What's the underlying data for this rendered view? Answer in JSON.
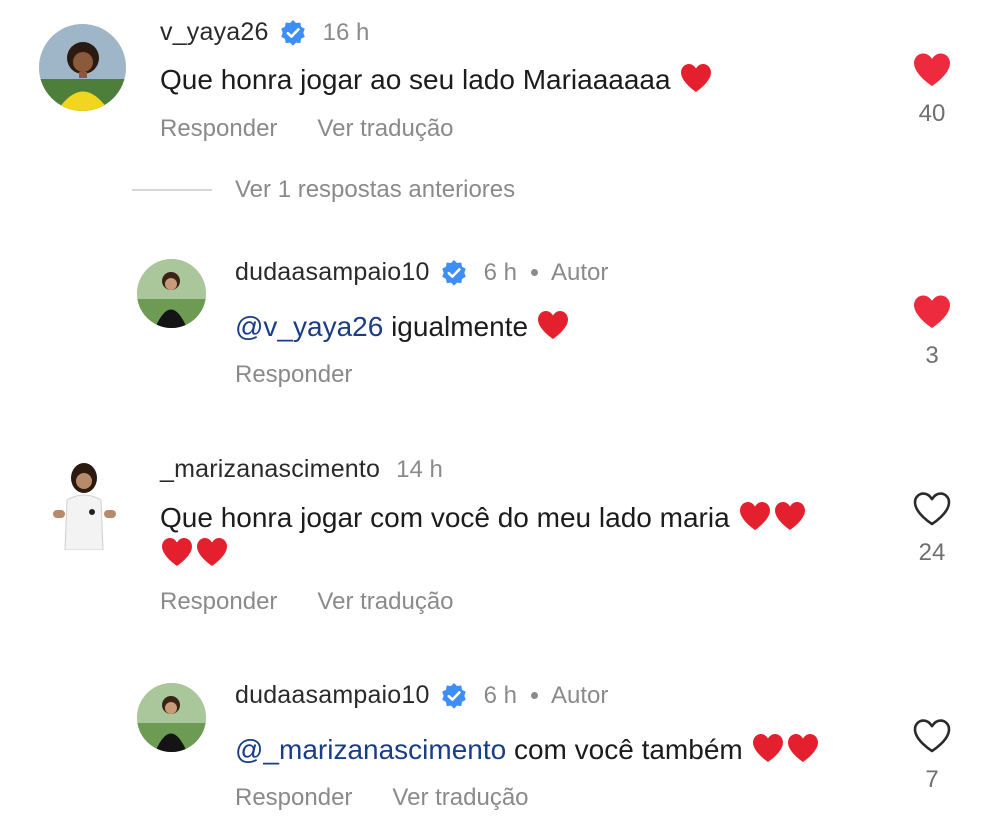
{
  "colors": {
    "mention": "#1a3e86",
    "verified": "#3e8ef7",
    "like_filled": "#ee2a3f",
    "muted_text": "#8a8a8a"
  },
  "comment1": {
    "username": "v_yaya26",
    "verified": true,
    "time": "16 h",
    "text": "Que honra jogar ao seu lado Mariaaaaaa",
    "emoji_hearts": 1,
    "actions": [
      "Responder",
      "Ver tradução"
    ],
    "liked": true,
    "like_icon": "heart-filled-icon",
    "like_count": "40"
  },
  "previous_replies": {
    "label": "Ver 1 respostas anteriores"
  },
  "reply1": {
    "username": "dudaasampaio10",
    "verified": true,
    "time": "6 h",
    "author_label": "Autor",
    "mention": "@v_yaya26",
    "text": " igualmente",
    "emoji_hearts": 1,
    "actions": [
      "Responder"
    ],
    "liked": true,
    "like_icon": "heart-filled-icon",
    "like_count": "3"
  },
  "comment2": {
    "username": "_marizanascimento",
    "verified": false,
    "time": "14 h",
    "text_line1": "Que honra jogar com você do meu lado maria",
    "emoji_hearts_line1": 2,
    "emoji_hearts_line2": 2,
    "actions": [
      "Responder",
      "Ver tradução"
    ],
    "liked": false,
    "like_icon": "heart-outline-icon",
    "like_count": "24"
  },
  "reply2": {
    "username": "dudaasampaio10",
    "verified": true,
    "time": "6 h",
    "author_label": "Autor",
    "mention": "@_marizanascimento",
    "text": " com você também",
    "emoji_hearts": 2,
    "actions": [
      "Responder",
      "Ver tradução"
    ],
    "liked": false,
    "like_icon": "heart-outline-icon",
    "like_count": "7"
  }
}
